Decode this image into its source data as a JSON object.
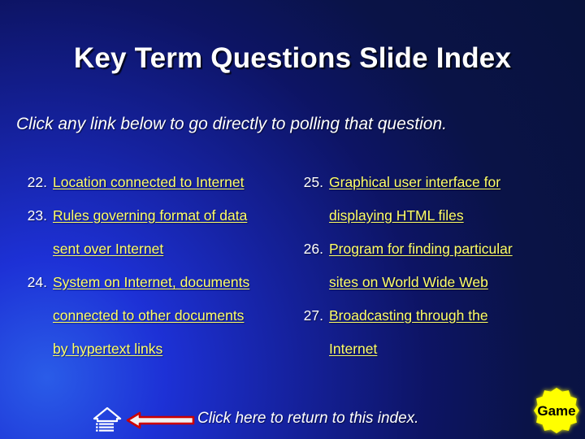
{
  "slide": {
    "title": "Key Term Questions Slide Index",
    "subtitle": "Click any link below to go directly to polling that question.",
    "title_color": "#ffffff",
    "link_color": "#ffff66",
    "background_colors": [
      "#2a5ce8",
      "#1d31d6",
      "#15219c",
      "#0d1464",
      "#08123c"
    ]
  },
  "columns": {
    "left": [
      {
        "number": "22.",
        "lines": [
          "Location connected to Internet"
        ]
      },
      {
        "number": "23.",
        "lines": [
          "Rules governing format of data",
          "sent over Internet"
        ]
      },
      {
        "number": "24.",
        "lines": [
          "System on Internet, documents",
          "connected to other documents",
          "by hypertext links"
        ]
      }
    ],
    "right": [
      {
        "number": "25.",
        "lines": [
          "Graphical user interface for",
          "displaying HTML files"
        ]
      },
      {
        "number": "26.",
        "lines": [
          "Program for finding particular",
          "sites on World Wide Web"
        ]
      },
      {
        "number": "27.",
        "lines": [
          "Broadcasting through the",
          "Internet"
        ]
      }
    ]
  },
  "footer": {
    "home_icon": "home-icon",
    "arrow_icon": "left-arrow-icon",
    "text": "Click here to return to this index.",
    "arrow_fill": "#f0f0f0",
    "arrow_stroke": "#cc0000"
  },
  "badge": {
    "label": "Game",
    "fill": "#ffff00",
    "text_color": "#000000"
  }
}
